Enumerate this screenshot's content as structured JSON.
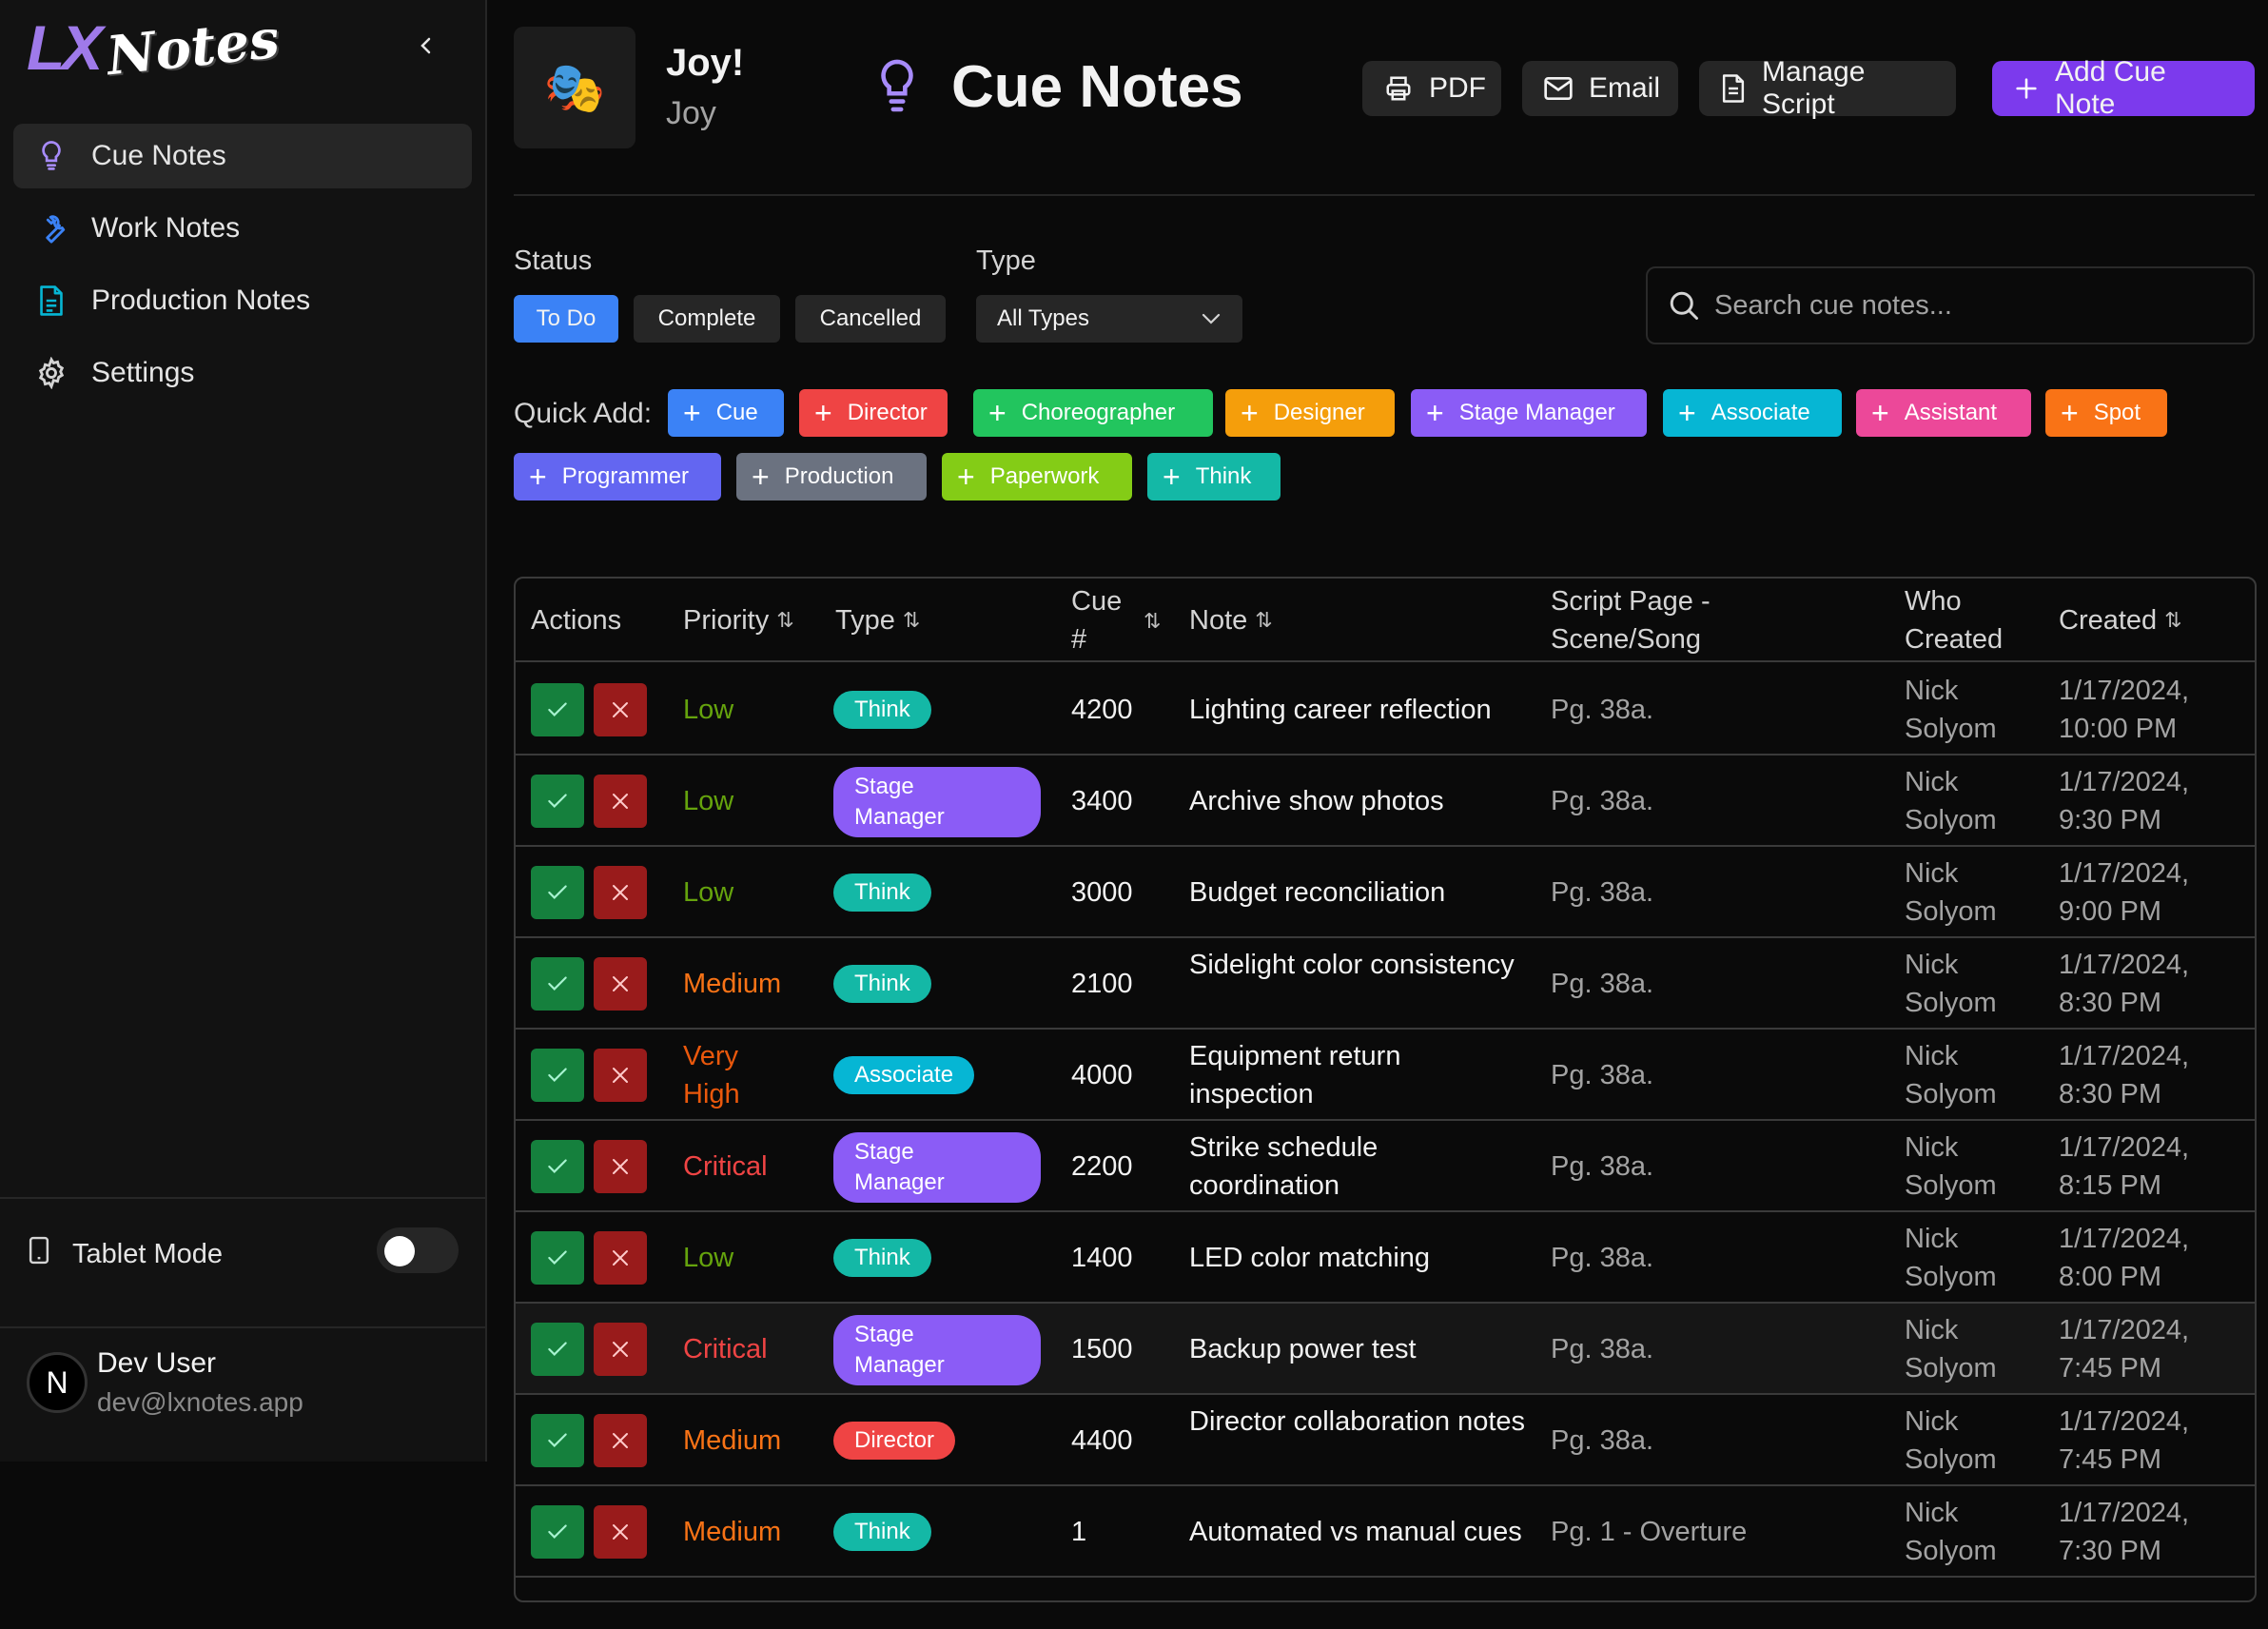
{
  "app": {
    "logo_lx": "LX",
    "logo_notes": "Notes"
  },
  "sidebar": {
    "items": [
      {
        "label": "Cue Notes",
        "icon": "lightbulb-icon",
        "active": true
      },
      {
        "label": "Work Notes",
        "icon": "wrench-icon",
        "active": false
      },
      {
        "label": "Production Notes",
        "icon": "document-icon",
        "active": false
      },
      {
        "label": "Settings",
        "icon": "gear-icon",
        "active": false
      }
    ],
    "tablet_mode_label": "Tablet Mode",
    "tablet_mode_on": false,
    "user": {
      "initial": "N",
      "name": "Dev User",
      "email": "dev@lxnotes.app"
    }
  },
  "header": {
    "production_name": "Joy!",
    "production_subtitle": "Joy",
    "production_icon": "🎭",
    "title": "Cue Notes",
    "buttons": {
      "pdf": "PDF",
      "email": "Email",
      "manage_script": "Manage Script",
      "add": "Add Cue Note"
    }
  },
  "filters": {
    "status_label": "Status",
    "status": [
      "To Do",
      "Complete",
      "Cancelled"
    ],
    "status_active": "To Do",
    "type_label": "Type",
    "type_value": "All Types",
    "search_placeholder": "Search cue notes..."
  },
  "quick_add": {
    "label": "Quick Add:",
    "items": [
      {
        "label": "Cue",
        "color": "#3b82f6"
      },
      {
        "label": "Director",
        "color": "#ef4444"
      },
      {
        "label": "Choreographer",
        "color": "#22c55e"
      },
      {
        "label": "Designer",
        "color": "#f59e0b"
      },
      {
        "label": "Stage Manager",
        "color": "#8b5cf6"
      },
      {
        "label": "Associate",
        "color": "#06b6d4"
      },
      {
        "label": "Assistant",
        "color": "#ec4899"
      },
      {
        "label": "Spot",
        "color": "#f97316"
      },
      {
        "label": "Programmer",
        "color": "#6366f1"
      },
      {
        "label": "Production",
        "color": "#6b7280"
      },
      {
        "label": "Paperwork",
        "color": "#84cc16"
      },
      {
        "label": "Think",
        "color": "#14b8a6"
      }
    ]
  },
  "table": {
    "headers": {
      "actions": "Actions",
      "priority": "Priority",
      "type": "Type",
      "cue": "Cue #",
      "note": "Note",
      "script_page": "Script Page - Scene/Song",
      "who": "Who Created",
      "created": "Created"
    },
    "rows": [
      {
        "priority": "Low",
        "type": "Think",
        "cue": "4200",
        "note": "Lighting career reflection",
        "page": "Pg. 38a.",
        "who": "Nick Solyom",
        "created": "1/17/2024, 10:00 PM"
      },
      {
        "priority": "Low",
        "type": "Stage Manager",
        "cue": "3400",
        "note": "Archive show photos",
        "page": "Pg. 38a.",
        "who": "Nick Solyom",
        "created": "1/17/2024, 9:30 PM"
      },
      {
        "priority": "Low",
        "type": "Think",
        "cue": "3000",
        "note": "Budget reconciliation",
        "page": "Pg. 38a.",
        "who": "Nick Solyom",
        "created": "1/17/2024, 9:00 PM"
      },
      {
        "priority": "Medium",
        "type": "Think",
        "cue": "2100",
        "note": "Sidelight color consistency",
        "page": "Pg. 38a.",
        "who": "Nick Solyom",
        "created": "1/17/2024, 8:30 PM"
      },
      {
        "priority": "Very High",
        "type": "Associate",
        "cue": "4000",
        "note": "Equipment return inspection",
        "page": "Pg. 38a.",
        "who": "Nick Solyom",
        "created": "1/17/2024, 8:30 PM"
      },
      {
        "priority": "Critical",
        "type": "Stage Manager",
        "cue": "2200",
        "note": "Strike schedule coordination",
        "page": "Pg. 38a.",
        "who": "Nick Solyom",
        "created": "1/17/2024, 8:15 PM"
      },
      {
        "priority": "Low",
        "type": "Think",
        "cue": "1400",
        "note": "LED color matching",
        "page": "Pg. 38a.",
        "who": "Nick Solyom",
        "created": "1/17/2024, 8:00 PM"
      },
      {
        "priority": "Critical",
        "type": "Stage Manager",
        "cue": "1500",
        "note": "Backup power test",
        "page": "Pg. 38a.",
        "who": "Nick Solyom",
        "created": "1/17/2024, 7:45 PM"
      },
      {
        "priority": "Medium",
        "type": "Director",
        "cue": "4400",
        "note": "Director collaboration notes",
        "page": "Pg. 38a.",
        "who": "Nick Solyom",
        "created": "1/17/2024, 7:45 PM"
      },
      {
        "priority": "Medium",
        "type": "Think",
        "cue": "1",
        "note": "Automated vs manual cues",
        "page": "Pg. 1 - Overture",
        "who": "Nick Solyom",
        "created": "1/17/2024, 7:30 PM"
      }
    ]
  },
  "colors": {
    "priority": {
      "Low": "#65a30d",
      "Medium": "#f97316",
      "Very High": "#ea580c",
      "Critical": "#ef4444"
    },
    "type": {
      "Think": "#14b8a6",
      "Stage Manager": "#8b5cf6",
      "Associate": "#06b6d4",
      "Director": "#ef4444"
    }
  }
}
